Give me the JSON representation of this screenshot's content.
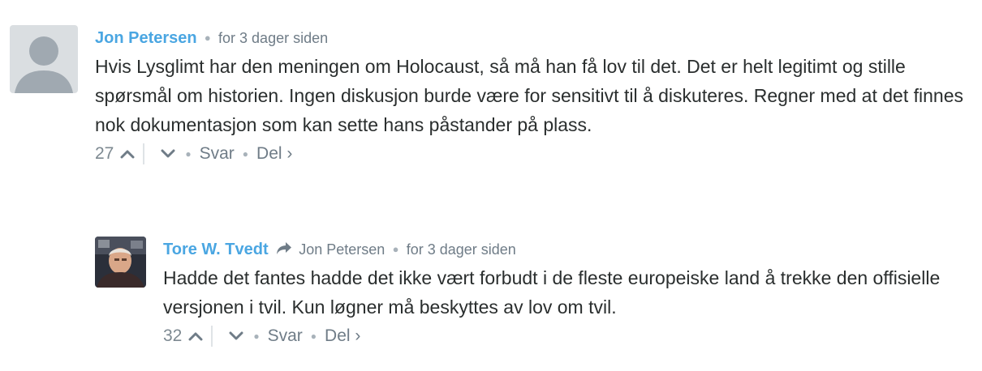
{
  "comments": [
    {
      "author": "Jon Petersen",
      "time": "for 3 dager siden",
      "text": "Hvis Lysglimt har den meningen om Holocaust, så må han få lov til det. Det er helt legitimt og stille spørsmål om historien. Ingen diskusjon burde være for sensitivt til å diskuteres. Regner med at det finnes nok dokumentasjon som kan sette hans påstander på plass.",
      "votes": "27",
      "reply_label": "Svar",
      "share_label": "Del ›"
    },
    {
      "author": "Tore W. Tvedt",
      "reply_to": "Jon Petersen",
      "time": "for 3 dager siden",
      "text": "Hadde det fantes hadde det ikke vært forbudt i de fleste europeiske land å trekke den offisielle versjonen i tvil. Kun løgner må beskyttes av lov om tvil.",
      "votes": "32",
      "reply_label": "Svar",
      "share_label": "Del ›"
    }
  ],
  "colors": {
    "author": "#4aa6e2",
    "meta": "#6f7c87",
    "text": "#2a2e2e"
  },
  "icons": {
    "upvote": "chevron-up-icon",
    "downvote": "chevron-down-icon",
    "reply_to": "share-arrow-icon",
    "default_avatar": "user-silhouette-icon"
  }
}
